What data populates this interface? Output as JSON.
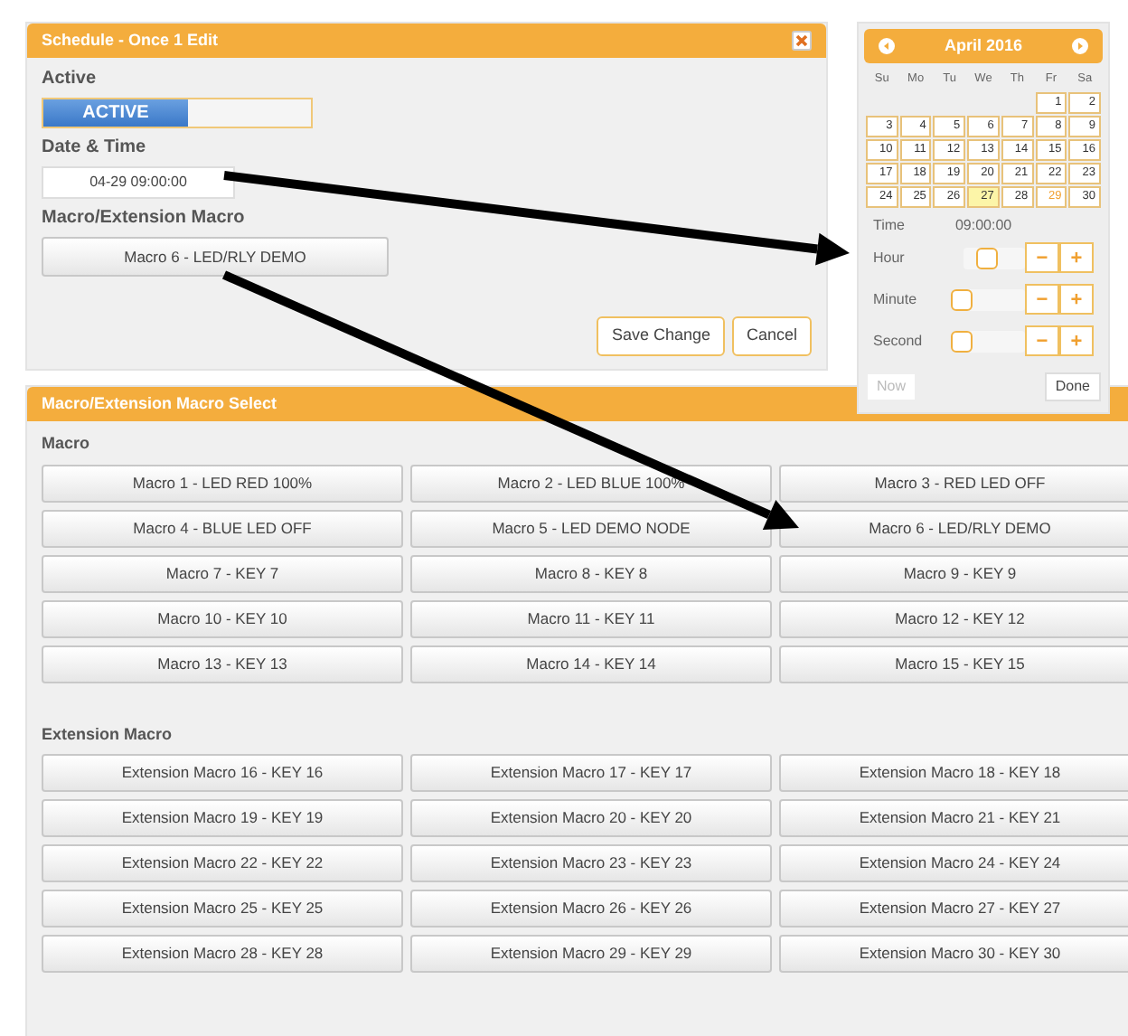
{
  "schedule_dialog": {
    "title": "Schedule - Once 1 Edit",
    "active_label": "Active",
    "active_toggle": {
      "label": "ACTIVE",
      "on": true
    },
    "datetime_label": "Date & Time",
    "datetime_value": "04-29 09:00:00",
    "macro_label": "Macro/Extension Macro",
    "macro_value": "Macro 6 - LED/RLY DEMO",
    "buttons": [
      "Save Change",
      "Cancel"
    ]
  },
  "calendar": {
    "title": "April 2016",
    "weekdays": [
      "Su",
      "Mo",
      "Tu",
      "We",
      "Th",
      "Fr",
      "Sa"
    ],
    "weeks": [
      [
        {
          "day": "1",
          "today": false,
          "selected": false
        },
        {
          "day": "2",
          "today": false,
          "selected": false
        }
      ],
      [
        {
          "day": "3",
          "today": false,
          "selected": false
        },
        {
          "day": "4",
          "today": false,
          "selected": false
        },
        {
          "day": "5",
          "today": false,
          "selected": false
        },
        {
          "day": "6",
          "today": false,
          "selected": false
        },
        {
          "day": "7",
          "today": false,
          "selected": false
        },
        {
          "day": "8",
          "today": false,
          "selected": false
        },
        {
          "day": "9",
          "today": false,
          "selected": false
        }
      ],
      [
        {
          "day": "10",
          "today": false,
          "selected": false
        },
        {
          "day": "11",
          "today": false,
          "selected": false
        },
        {
          "day": "12",
          "today": false,
          "selected": false
        },
        {
          "day": "13",
          "today": false,
          "selected": false
        },
        {
          "day": "14",
          "today": false,
          "selected": false
        },
        {
          "day": "15",
          "today": false,
          "selected": false
        },
        {
          "day": "16",
          "today": false,
          "selected": false
        }
      ],
      [
        {
          "day": "17",
          "today": false,
          "selected": false
        },
        {
          "day": "18",
          "today": false,
          "selected": false
        },
        {
          "day": "19",
          "today": false,
          "selected": false
        },
        {
          "day": "20",
          "today": false,
          "selected": false
        },
        {
          "day": "21",
          "today": false,
          "selected": false
        },
        {
          "day": "22",
          "today": false,
          "selected": false
        },
        {
          "day": "23",
          "today": false,
          "selected": false
        }
      ],
      [
        {
          "day": "24",
          "today": false,
          "selected": false
        },
        {
          "day": "25",
          "today": false,
          "selected": false
        },
        {
          "day": "26",
          "today": false,
          "selected": false
        },
        {
          "day": "27",
          "today": true,
          "selected": false
        },
        {
          "day": "28",
          "today": false,
          "selected": false
        },
        {
          "day": "29",
          "today": false,
          "selected": true
        },
        {
          "day": "30",
          "today": false,
          "selected": false
        }
      ]
    ],
    "time_label": "Time",
    "time_value": "09:00:00",
    "sliders": [
      {
        "label": "Hour",
        "level": 0.4,
        "minus": "−",
        "plus": "+"
      },
      {
        "label": "Minute",
        "level": 0,
        "minus": "−",
        "plus": "+"
      },
      {
        "label": "Second",
        "level": 0,
        "minus": "−",
        "plus": "+"
      }
    ],
    "buttons": [
      {
        "label": "Now",
        "disabled": true
      },
      {
        "label": "Done",
        "disabled": false
      }
    ]
  },
  "macro_select": {
    "title": "Macro/Extension Macro Select",
    "sections": [
      {
        "heading": "Macro",
        "items": [
          "Macro 1 - LED RED 100%",
          "Macro 2 - LED BLUE 100%",
          "Macro 3 - RED LED OFF",
          "Macro 4 - BLUE LED OFF",
          "Macro 5 - LED DEMO NODE",
          "Macro 6 - LED/RLY DEMO",
          "Macro 7 - KEY 7",
          "Macro 8 - KEY 8",
          "Macro 9 - KEY 9",
          "Macro 10 - KEY 10",
          "Macro 11 - KEY 11",
          "Macro 12 - KEY 12",
          "Macro 13 - KEY 13",
          "Macro 14 - KEY 14",
          "Macro 15 - KEY 15"
        ]
      },
      {
        "heading": "Extension Macro",
        "items": [
          "Extension Macro 16 - KEY 16",
          "Extension Macro 17 - KEY 17",
          "Extension Macro 18 - KEY 18",
          "Extension Macro 19 - KEY 19",
          "Extension Macro 20 - KEY 20",
          "Extension Macro 21 - KEY 21",
          "Extension Macro 22 - KEY 22",
          "Extension Macro 23 - KEY 23",
          "Extension Macro 24 - KEY 24",
          "Extension Macro 25 - KEY 25",
          "Extension Macro 26 - KEY 26",
          "Extension Macro 27 - KEY 27",
          "Extension Macro 28 - KEY 28",
          "Extension Macro 29 - KEY 29",
          "Extension Macro 30 - KEY 30"
        ]
      }
    ]
  }
}
